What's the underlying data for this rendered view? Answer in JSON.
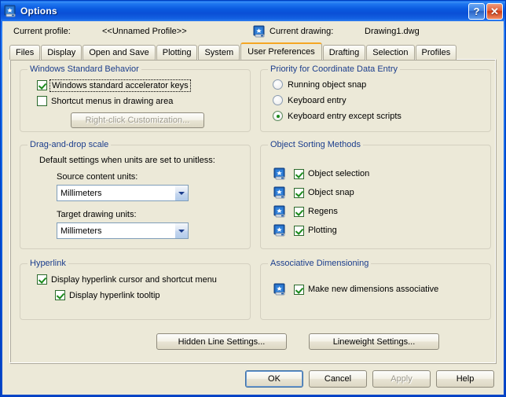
{
  "window": {
    "title": "Options",
    "icon": "autocad-drawing-icon",
    "help_button": "?",
    "close_button": "✕"
  },
  "profile_bar": {
    "profile_label": "Current profile:",
    "profile_value": "<<Unnamed Profile>>",
    "drawing_icon": "autocad-drawing-icon",
    "drawing_label": "Current drawing:",
    "drawing_value": "Drawing1.dwg"
  },
  "tabs": [
    {
      "label": "Files",
      "active": false
    },
    {
      "label": "Display",
      "active": false
    },
    {
      "label": "Open and Save",
      "active": false
    },
    {
      "label": "Plotting",
      "active": false
    },
    {
      "label": "System",
      "active": false
    },
    {
      "label": "User Preferences",
      "active": true
    },
    {
      "label": "Drafting",
      "active": false
    },
    {
      "label": "Selection",
      "active": false
    },
    {
      "label": "Profiles",
      "active": false
    }
  ],
  "groups": {
    "windows_standard_behavior": {
      "title": "Windows Standard Behavior",
      "accelerator_keys": {
        "label": "Windows standard accelerator keys",
        "checked": true,
        "focused": true
      },
      "shortcut_menus": {
        "label": "Shortcut menus in drawing area",
        "checked": false
      },
      "right_click_button": {
        "label": "Right-click Customization...",
        "disabled": true
      }
    },
    "drag_and_drop_scale": {
      "title": "Drag-and-drop scale",
      "description": "Default settings when units are set to unitless:",
      "source_label": "Source content units:",
      "source_value": "Millimeters",
      "target_label": "Target drawing units:",
      "target_value": "Millimeters"
    },
    "hyperlink": {
      "title": "Hyperlink",
      "display_cursor": {
        "label": "Display hyperlink cursor and shortcut menu",
        "checked": true
      },
      "display_tooltip": {
        "label": "Display hyperlink tooltip",
        "checked": true
      }
    },
    "priority_coordinate_data_entry": {
      "title": "Priority for Coordinate Data Entry",
      "options": [
        {
          "label": "Running object snap",
          "selected": false
        },
        {
          "label": "Keyboard entry",
          "selected": false
        },
        {
          "label": "Keyboard entry except scripts",
          "selected": true
        }
      ]
    },
    "object_sorting_methods": {
      "title": "Object Sorting Methods",
      "items": [
        {
          "label": "Object selection",
          "checked": true,
          "icon": "autocad-drawing-icon"
        },
        {
          "label": "Object snap",
          "checked": true,
          "icon": "autocad-drawing-icon"
        },
        {
          "label": "Regens",
          "checked": true,
          "icon": "autocad-drawing-icon"
        },
        {
          "label": "Plotting",
          "checked": true,
          "icon": "autocad-drawing-icon"
        }
      ]
    },
    "associative_dimensioning": {
      "title": "Associative Dimensioning",
      "make_associative": {
        "label": "Make new dimensions associative",
        "checked": true,
        "icon": "autocad-drawing-icon"
      }
    }
  },
  "settings_buttons": {
    "hidden_line": "Hidden Line Settings...",
    "lineweight": "Lineweight Settings..."
  },
  "dialog_buttons": {
    "ok": "OK",
    "cancel": "Cancel",
    "apply": "Apply",
    "apply_disabled": true,
    "help": "Help"
  },
  "colors": {
    "dialog_face": "#ece9d8",
    "group_title": "#1b3d8c",
    "active_tab_accent": "#f5a623",
    "titlebar_blue": "#0a5ce0",
    "check_green": "#1a8a1a"
  }
}
